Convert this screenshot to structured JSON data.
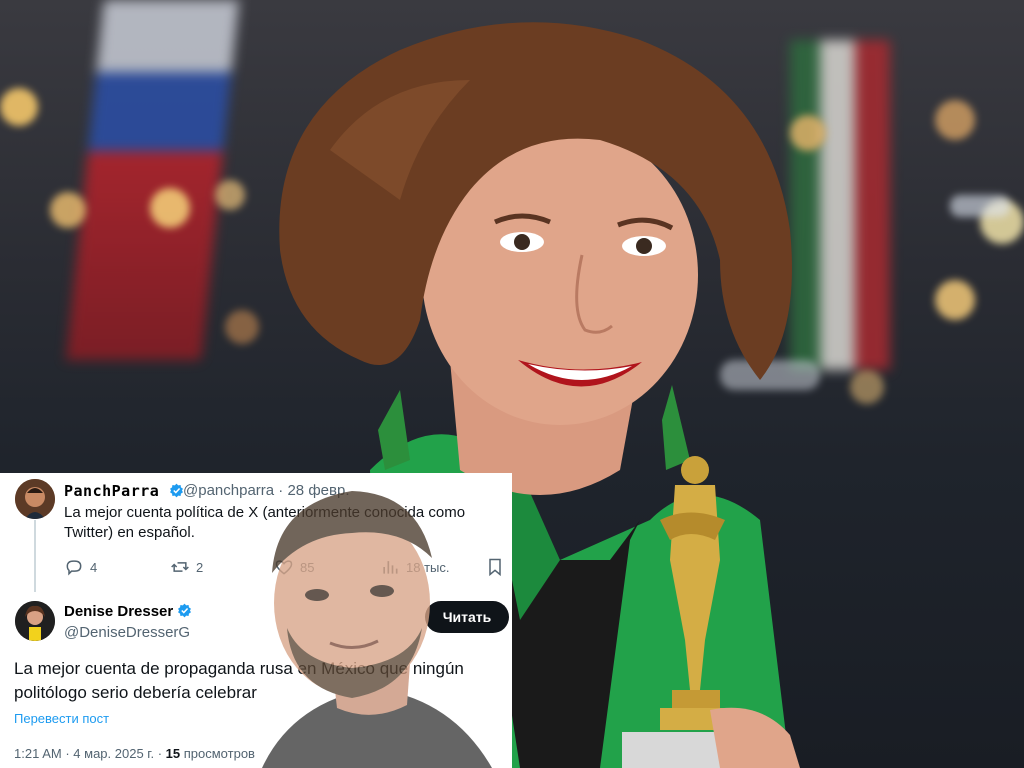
{
  "tweet1": {
    "display_name": "PanchParra",
    "handle": "@panchparra",
    "separator": "·",
    "date": "28 февр.",
    "text": "La mejor cuenta política de X (anteriormente conocida como Twitter) en español.",
    "replies": "4",
    "reposts": "2",
    "likes": "85",
    "views": "18 тыс."
  },
  "tweet2": {
    "display_name": "Denise Dresser",
    "handle": "@DeniseDresserG",
    "follow_label": "Читать",
    "text": "La mejor cuenta de propaganda rusa en México que ningún politólogo serio debería celebrar",
    "translate_label": "Перевести пост",
    "time": "1:21 AM",
    "separator": "·",
    "date": "4 мар. 2025 г.",
    "dot": "·",
    "views_count": "15",
    "views_label": "просмотров"
  },
  "colors": {
    "accent_blue": "#1d9bf0",
    "text_dark": "#0f1419",
    "text_muted": "#536471",
    "jacket_green": "#22a24a"
  },
  "icons": [
    "reply-icon",
    "repost-icon",
    "like-icon",
    "views-icon",
    "bookmark-icon",
    "verified-badge-icon"
  ]
}
